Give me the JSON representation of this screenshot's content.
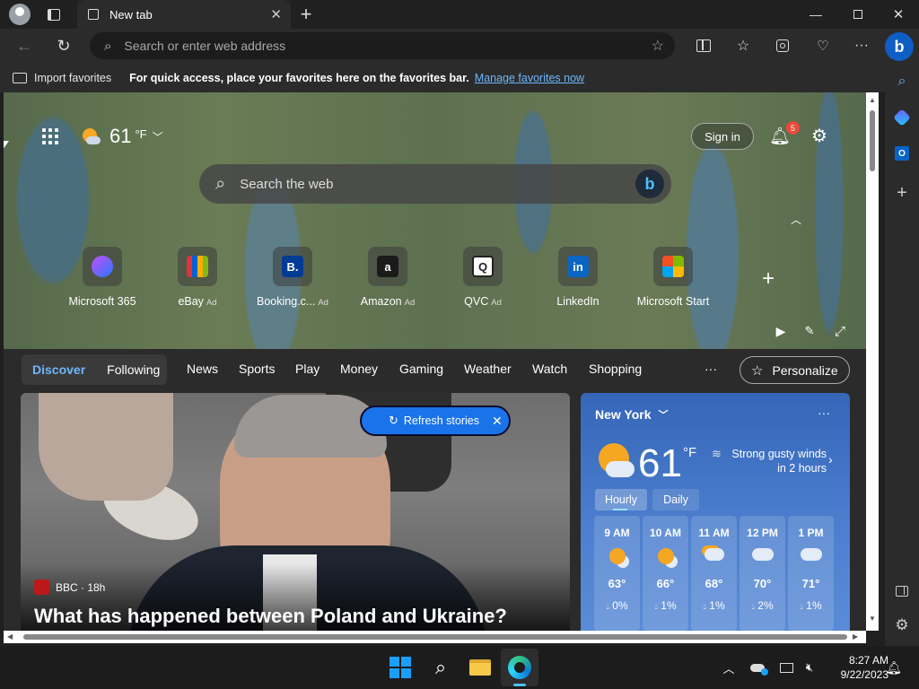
{
  "tab": {
    "title": "New tab"
  },
  "address": {
    "placeholder": "Search or enter web address"
  },
  "favorites_bar": {
    "import_label": "Import favorites",
    "message": "For quick access, place your favorites here on the favorites bar.",
    "manage_link": "Manage favorites now"
  },
  "header": {
    "weather_temp": "61",
    "weather_unit": "°F",
    "sign_in": "Sign in",
    "notification_count": "5"
  },
  "search": {
    "placeholder": "Search the web"
  },
  "shortcuts": [
    {
      "label": "Microsoft 365",
      "ad": ""
    },
    {
      "label": "eBay",
      "ad": "Ad"
    },
    {
      "label": "Booking.c...",
      "ad": "Ad"
    },
    {
      "label": "Amazon",
      "ad": "Ad"
    },
    {
      "label": "QVC",
      "ad": "Ad"
    },
    {
      "label": "LinkedIn",
      "ad": ""
    },
    {
      "label": "Microsoft Start",
      "ad": ""
    }
  ],
  "feed_nav": {
    "discover": "Discover",
    "following": "Following",
    "items": [
      "News",
      "Sports",
      "Play",
      "Money",
      "Gaming",
      "Weather",
      "Watch",
      "Shopping"
    ],
    "more": "···",
    "personalize": "Personalize"
  },
  "story": {
    "refresh": "Refresh stories",
    "source": "BBC · 18h",
    "headline": "What has happened between Poland and Ukraine?"
  },
  "weather_card": {
    "location": "New York",
    "temp": "61",
    "unit": "°F",
    "alert": "Strong gusty winds in 2 hours",
    "tab_hourly": "Hourly",
    "tab_daily": "Daily",
    "hours": [
      {
        "time": "9 AM",
        "temp": "63°",
        "precip": "0%",
        "icon": "partly-sunny"
      },
      {
        "time": "10 AM",
        "temp": "66°",
        "precip": "1%",
        "icon": "partly-sunny"
      },
      {
        "time": "11 AM",
        "temp": "68°",
        "precip": "1%",
        "icon": "partly-cloudy"
      },
      {
        "time": "12 PM",
        "temp": "70°",
        "precip": "2%",
        "icon": "cloudy"
      },
      {
        "time": "1 PM",
        "temp": "71°",
        "precip": "1%",
        "icon": "cloudy"
      }
    ]
  },
  "taskbar": {
    "time": "8:27 AM",
    "date": "9/22/2023"
  },
  "colors": {
    "accent": "#4cc2ff",
    "link": "#6eb7ff",
    "windows_blue": "#1a9fff"
  }
}
